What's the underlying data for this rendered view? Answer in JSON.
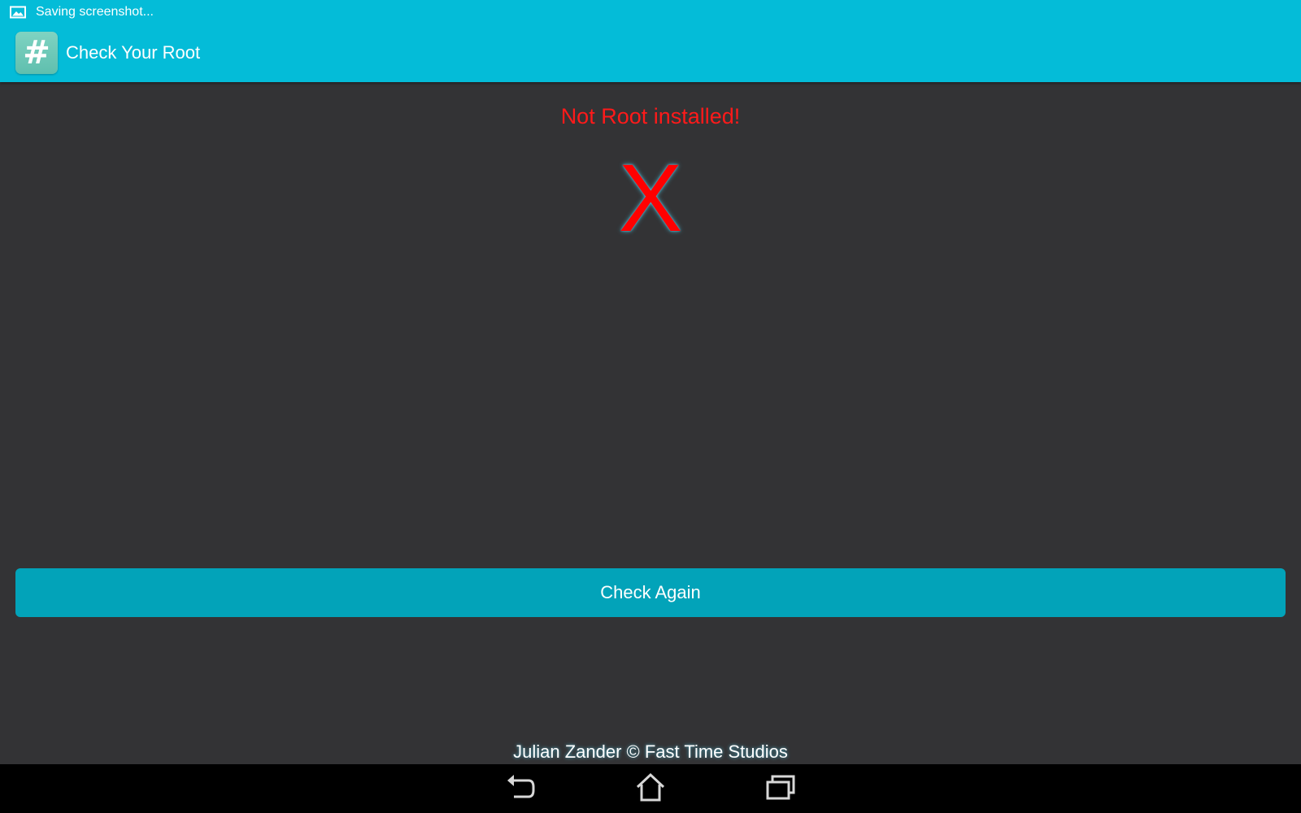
{
  "status_bar": {
    "notification_icon": "image-icon",
    "notification_text": "Saving screenshot..."
  },
  "app_bar": {
    "icon": "hash-icon",
    "icon_glyph": "#",
    "title": "Check Your Root"
  },
  "main": {
    "status_message": "Not Root installed!",
    "status_mark": "X",
    "check_button_label": "Check Again",
    "credit": "Julian Zander © Fast Time Studios"
  },
  "navigation_bar": {
    "buttons": [
      {
        "name": "back",
        "icon": "back-icon"
      },
      {
        "name": "home",
        "icon": "home-icon"
      },
      {
        "name": "recents",
        "icon": "recent-apps-icon"
      }
    ]
  },
  "colors": {
    "top_bar": "#04bcd8",
    "background": "#333335",
    "button": "#02a3b9",
    "error": "#ff0000"
  }
}
